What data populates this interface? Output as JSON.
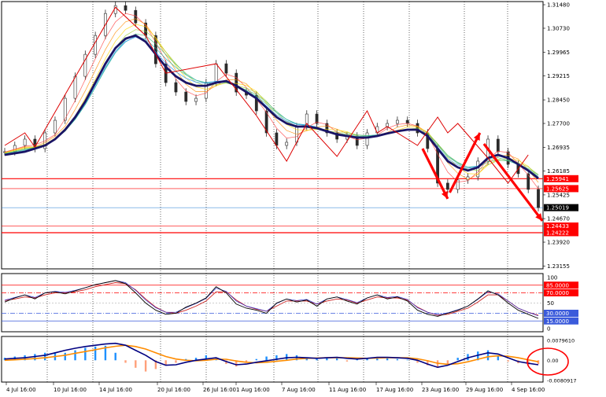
{
  "colors": {
    "background": "#ffffff",
    "panel_border": "#000000",
    "grid_vertical": "#000000",
    "price_line": "#1976d2",
    "hline_red": "#ff0000",
    "hline_dark_red": "#cc0000",
    "slow_ma": "#1a1466",
    "arrow": "#ff0000",
    "zigzag": "#dd0000",
    "candle": "#2b2b2b",
    "stoch_main": "#000000",
    "stoch_signal": "#cc2222",
    "stoch_third": "#3333cc",
    "macd_main": "#000080",
    "macd_signal": "#ff8c00",
    "hist_pos": "#1e90ff",
    "hist_neg": "#ffa07a",
    "circle": "#ff0000"
  },
  "chart_data": [
    {
      "type": "line",
      "title": "",
      "panel": "price",
      "ylim": [
        1.2322,
        1.3148
      ],
      "y_ticks": [
        "1.31480",
        "1.30730",
        "1.29965",
        "1.29215",
        "1.28450",
        "1.27700",
        "1.26935",
        "1.26185",
        "1.25425",
        "1.24670",
        "1.23920",
        "1.23155"
      ],
      "marked_levels": [
        {
          "label": "1.25941",
          "value": 1.25941,
          "kind": "red-line"
        },
        {
          "label": "1.25625",
          "value": 1.25625,
          "kind": "red-box"
        },
        {
          "label": "1.25019",
          "value": 1.25019,
          "kind": "current-price"
        },
        {
          "label": "1.24433",
          "value": 1.24433,
          "kind": "red-box"
        },
        {
          "label": "1.24222",
          "value": 1.24222,
          "kind": "red-line"
        }
      ],
      "close": [
        1.268,
        1.27,
        1.272,
        1.269,
        1.274,
        1.278,
        1.285,
        1.292,
        1.299,
        1.305,
        1.312,
        1.3145,
        1.313,
        1.309,
        1.305,
        1.296,
        1.29,
        1.287,
        1.284,
        1.285,
        1.29,
        1.296,
        1.293,
        1.287,
        1.286,
        1.281,
        1.274,
        1.27,
        1.271,
        1.276,
        1.28,
        1.277,
        1.274,
        1.272,
        1.273,
        1.27,
        1.274,
        1.276,
        1.277,
        1.278,
        1.277,
        1.274,
        1.269,
        1.258,
        1.256,
        1.259,
        1.26,
        1.265,
        1.272,
        1.268,
        1.264,
        1.261,
        1.256,
        1.2502
      ],
      "slow_ma": [
        1.267,
        1.2675,
        1.268,
        1.269,
        1.27,
        1.272,
        1.275,
        1.279,
        1.284,
        1.29,
        1.296,
        1.301,
        1.304,
        1.305,
        1.303,
        1.299,
        1.295,
        1.292,
        1.29,
        1.289,
        1.289,
        1.29,
        1.2905,
        1.289,
        1.287,
        1.285,
        1.282,
        1.279,
        1.277,
        1.276,
        1.276,
        1.2755,
        1.2745,
        1.2735,
        1.273,
        1.2725,
        1.2725,
        1.273,
        1.2738,
        1.2745,
        1.275,
        1.275,
        1.273,
        1.269,
        1.265,
        1.263,
        1.262,
        1.263,
        1.266,
        1.267,
        1.266,
        1.264,
        1.262,
        1.2595
      ],
      "zigzag_points": [
        [
          0,
          1.27
        ],
        [
          2,
          1.274
        ],
        [
          3,
          1.2695
        ],
        [
          11,
          1.314
        ],
        [
          14,
          1.305
        ],
        [
          16,
          1.293
        ],
        [
          21,
          1.296
        ],
        [
          25,
          1.2795
        ],
        [
          28,
          1.265
        ],
        [
          30,
          1.277
        ],
        [
          33,
          1.2665
        ],
        [
          36,
          1.281
        ],
        [
          37,
          1.274
        ],
        [
          38,
          1.276
        ],
        [
          41,
          1.27
        ],
        [
          43,
          1.279
        ],
        [
          44,
          1.274
        ],
        [
          45,
          1.277
        ],
        [
          48,
          1.266
        ],
        [
          50,
          1.258
        ],
        [
          52,
          1.267
        ]
      ],
      "arrows": [
        {
          "from": [
            41.5,
            1.269
          ],
          "to": [
            44,
            1.253
          ]
        },
        {
          "from": [
            44.2,
            1.255
          ],
          "to": [
            47.2,
            1.274
          ]
        },
        {
          "from": [
            47.6,
            1.2705
          ],
          "to": [
            53.4,
            1.246
          ]
        }
      ]
    },
    {
      "type": "line",
      "title": "",
      "panel": "stochastic",
      "ylim": [
        0,
        100
      ],
      "y_ticks": [
        "100",
        "50",
        "0"
      ],
      "levels": [
        {
          "label": "85.0000",
          "value": 85,
          "style": "solid"
        },
        {
          "label": "70.0000",
          "value": 70,
          "style": "dashdot"
        },
        {
          "label": "30.0000",
          "value": 30,
          "style": "dashdot"
        },
        {
          "label": "15.0000",
          "value": 15,
          "style": "solid"
        }
      ],
      "main": [
        52,
        60,
        66,
        58,
        70,
        72,
        68,
        74,
        80,
        86,
        90,
        94,
        88,
        70,
        50,
        36,
        28,
        30,
        42,
        50,
        60,
        82,
        70,
        48,
        40,
        36,
        30,
        50,
        58,
        52,
        56,
        44,
        58,
        62,
        54,
        48,
        60,
        66,
        58,
        62,
        54,
        36,
        28,
        24,
        30,
        36,
        44,
        58,
        74,
        66,
        50,
        36,
        28,
        20
      ],
      "signal": [
        55,
        58,
        62,
        60,
        66,
        70,
        70,
        72,
        76,
        82,
        86,
        90,
        88,
        76,
        58,
        42,
        32,
        30,
        36,
        44,
        54,
        72,
        72,
        56,
        44,
        38,
        34,
        44,
        54,
        54,
        54,
        48,
        54,
        58,
        56,
        50,
        56,
        62,
        60,
        60,
        56,
        42,
        32,
        26,
        28,
        34,
        40,
        52,
        66,
        66,
        54,
        40,
        32,
        26
      ]
    },
    {
      "type": "bar",
      "title": "",
      "panel": "macd",
      "ylim": [
        -0.0080917,
        0.007961
      ],
      "y_ticks": [
        "0.0079610",
        "0.00",
        "-0.0080917"
      ],
      "histogram": [
        0.001,
        0.0015,
        0.002,
        0.0025,
        0.003,
        0.0032,
        0.003,
        0.004,
        0.005,
        0.0055,
        0.0058,
        0.003,
        -0.001,
        -0.003,
        -0.0045,
        -0.0035,
        -0.002,
        -0.001,
        0.0005,
        0.001,
        0.002,
        0.001,
        -0.0015,
        -0.0025,
        -0.001,
        0.0005,
        0.0015,
        0.002,
        0.0025,
        0.002,
        0.001,
        0.0005,
        0.001,
        0.0008,
        -0.0005,
        0.0003,
        0.001,
        0.0012,
        0.0008,
        0.0005,
        0.0002,
        -0.001,
        -0.002,
        -0.003,
        -0.002,
        0.001,
        0.0025,
        0.0035,
        0.004,
        0.002,
        -0.0005,
        -0.0012,
        -0.0018,
        -0.0015
      ],
      "main": [
        0.0005,
        0.0008,
        0.001,
        0.0015,
        0.002,
        0.003,
        0.004,
        0.0048,
        0.0055,
        0.006,
        0.0065,
        0.0068,
        0.006,
        0.004,
        0.002,
        -0.0005,
        -0.002,
        -0.0018,
        -0.0008,
        0.0,
        0.0005,
        0.001,
        -0.0005,
        -0.0018,
        -0.0015,
        -0.0008,
        -0.0002,
        0.0004,
        0.001,
        0.0012,
        0.001,
        0.0008,
        0.001,
        0.0012,
        0.0008,
        0.0005,
        0.0008,
        0.0012,
        0.0012,
        0.001,
        0.0008,
        0.0,
        -0.0015,
        -0.0028,
        -0.002,
        -0.0005,
        0.001,
        0.002,
        0.003,
        0.0025,
        0.001,
        -0.0005,
        -0.0012,
        -0.0018
      ],
      "signal": [
        0.0,
        0.0002,
        0.0004,
        0.0007,
        0.001,
        0.0015,
        0.002,
        0.0028,
        0.0035,
        0.0042,
        0.005,
        0.0056,
        0.006,
        0.0055,
        0.0045,
        0.003,
        0.0015,
        0.0005,
        0.0,
        -0.0002,
        0.0,
        0.0004,
        0.0004,
        -0.0003,
        -0.0008,
        -0.001,
        -0.0008,
        -0.0004,
        0.0,
        0.0005,
        0.0008,
        0.0009,
        0.001,
        0.001,
        0.001,
        0.0009,
        0.0008,
        0.0009,
        0.001,
        0.001,
        0.001,
        0.0006,
        -0.0002,
        -0.0012,
        -0.0016,
        -0.0014,
        -0.0006,
        0.0004,
        0.0014,
        0.0018,
        0.0016,
        0.001,
        0.0002,
        -0.0006
      ]
    }
  ],
  "x_labels": [
    "4 Jul 16:00",
    "10 Jul 16:00",
    "14 Jul 16:00",
    "20 Jul 16:00",
    "26 Jul 16:00",
    "1 Aug 16:00",
    "7 Aug 16:00",
    "11 Aug 16:00",
    "17 Aug 16:00",
    "23 Aug 16:00",
    "29 Aug 16:00",
    "4 Sep 16:00"
  ]
}
